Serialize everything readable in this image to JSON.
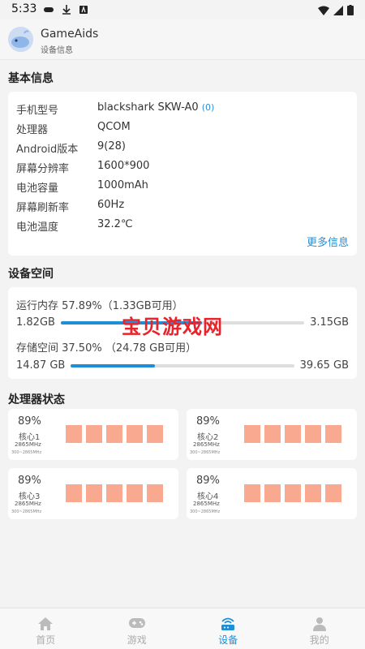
{
  "status_bar": {
    "time": "5:33"
  },
  "header": {
    "title": "GameAids",
    "subtitle": "设备信息"
  },
  "basic_info": {
    "section_title": "基本信息",
    "rows": [
      {
        "label": "手机型号",
        "value": "blackshark SKW-A0",
        "extra": "(0)"
      },
      {
        "label": "处理器",
        "value": "QCOM"
      },
      {
        "label": "Android版本",
        "value": "9(28)"
      },
      {
        "label": "屏幕分辨率",
        "value": "1600*900"
      },
      {
        "label": "电池容量",
        "value": "1000mAh"
      },
      {
        "label": "屏幕刷新率",
        "value": "60Hz"
      },
      {
        "label": "电池温度",
        "value": "32.2℃"
      }
    ],
    "more_link": "更多信息"
  },
  "storage": {
    "section_title": "设备空间",
    "ram": {
      "title": "运行内存 57.89%（1.33GB可用）",
      "used": "1.82GB",
      "total": "3.15GB",
      "fill_fraction": 0.5789
    },
    "rom": {
      "title": "存储空间 37.50% （24.78 GB可用）",
      "used": "14.87 GB",
      "total": "39.65 GB",
      "fill_fraction": 0.375
    }
  },
  "watermark": "宝贝游戏网",
  "cpu": {
    "section_title": "处理器状态",
    "cores": [
      {
        "percent": "89%",
        "name": "核心1",
        "freq": "2865MHz",
        "range": "300~2865MHz"
      },
      {
        "percent": "89%",
        "name": "核心2",
        "freq": "2865MHz",
        "range": "300~2865MHz"
      },
      {
        "percent": "89%",
        "name": "核心3",
        "freq": "2865MHz",
        "range": "300~2865MHz"
      },
      {
        "percent": "89%",
        "name": "核心4",
        "freq": "2865MHz",
        "range": "300~2865MHz"
      }
    ]
  },
  "nav": {
    "items": [
      {
        "label": "首页",
        "icon": "home-icon"
      },
      {
        "label": "游戏",
        "icon": "gamepad-icon"
      },
      {
        "label": "设备",
        "icon": "device-icon",
        "active": true
      },
      {
        "label": "我的",
        "icon": "person-icon"
      }
    ]
  },
  "colors": {
    "accent": "#1e8fd6",
    "core_block": "#f8a98f",
    "watermark": "#e8232b"
  }
}
